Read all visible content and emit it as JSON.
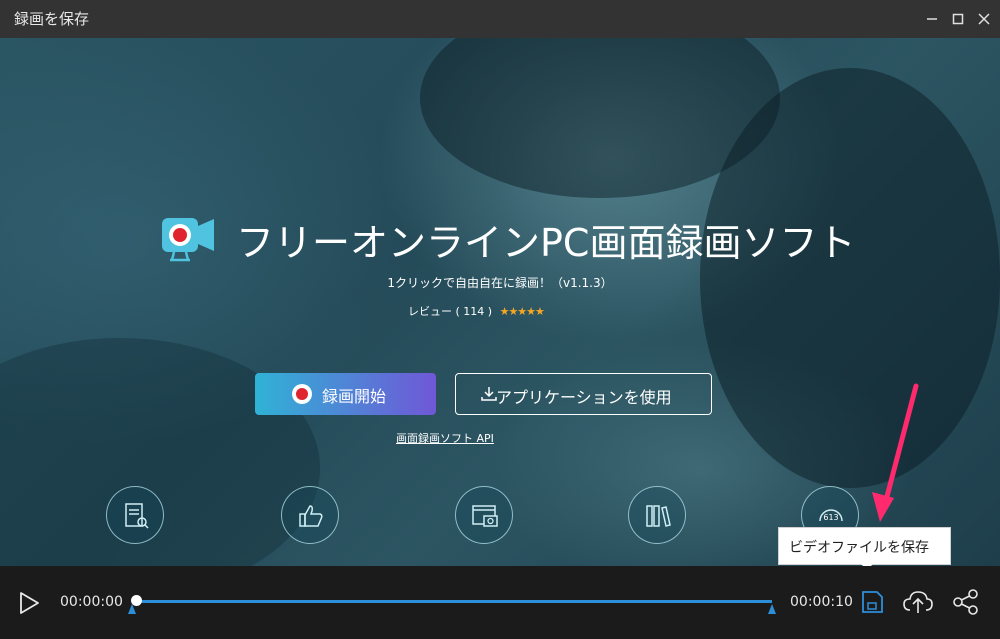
{
  "window": {
    "title": "録画を保存",
    "minimize_icon": "minimize-icon",
    "maximize_icon": "maximize-icon",
    "close_icon": "close-icon"
  },
  "preview": {
    "brand_title": "フリーオンラインPC画面録画ソフト",
    "subtitle": "1クリックで自由自在に録画！（v1.1.3）",
    "review_label": "レビュー",
    "review_count": "( 114 )",
    "rating_stars": 5,
    "record_button_label": "録画開始",
    "app_button_label": "アプリケーションを使用",
    "api_link": "画面録画ソフト API",
    "features": [
      {
        "icon": "document-search-icon"
      },
      {
        "icon": "thumbs-up-icon"
      },
      {
        "icon": "browser-camera-icon"
      },
      {
        "icon": "books-icon"
      },
      {
        "icon": "counter-badge-icon",
        "value": "613"
      }
    ]
  },
  "tooltip": {
    "text": "ビデオファイルを保存"
  },
  "controls": {
    "current_time": "00:00:00",
    "total_time": "00:00:10",
    "progress": 0.0
  },
  "colors": {
    "accent": "#2d8fd8",
    "record_gradient_start": "#2fb3d6",
    "record_gradient_end": "#7057d7",
    "annotation_arrow": "#ff2a6d"
  }
}
